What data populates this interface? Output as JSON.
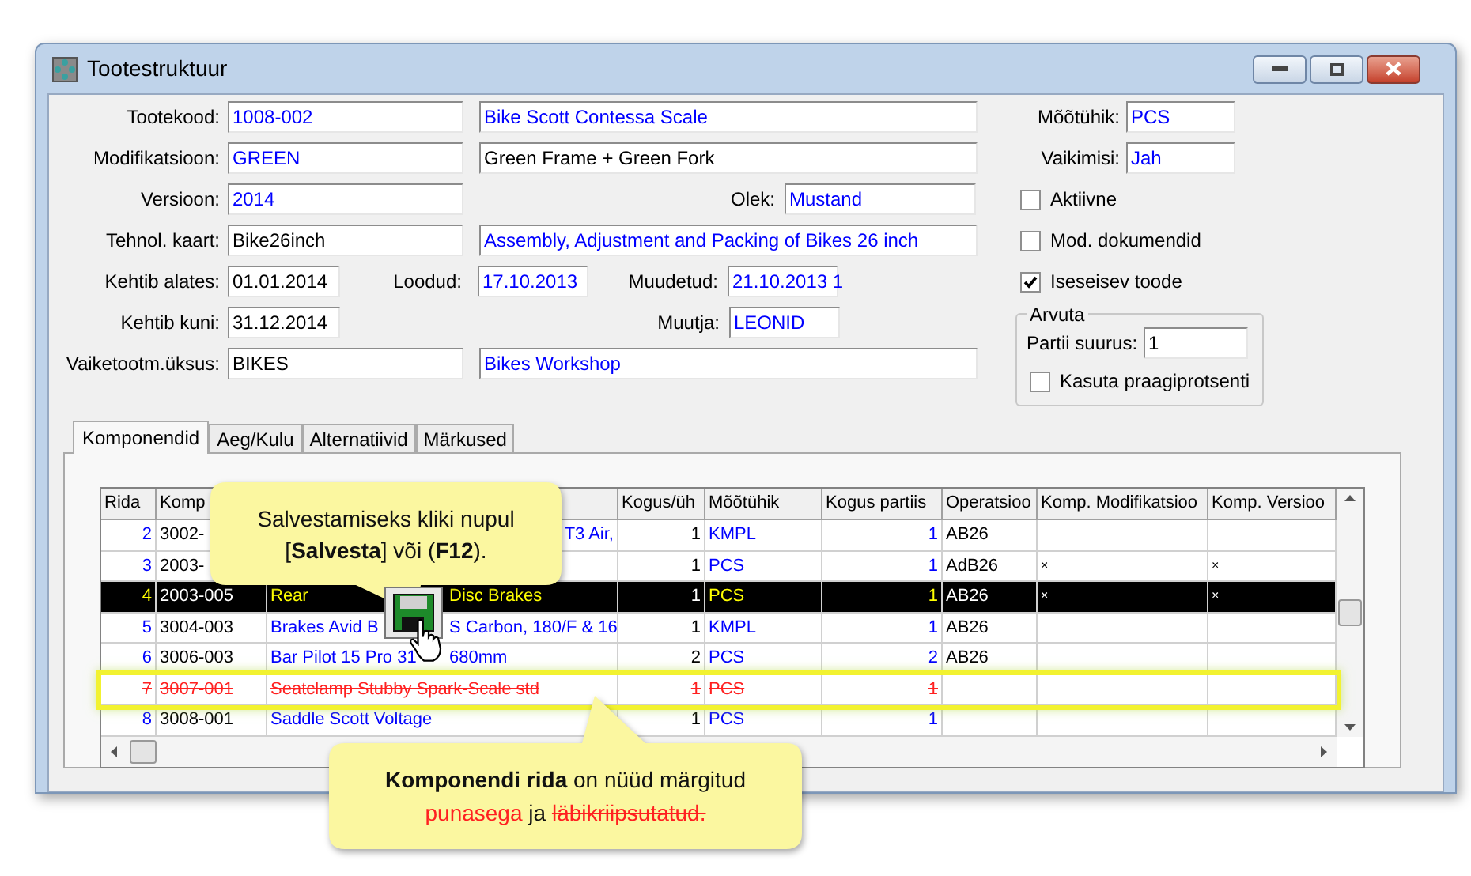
{
  "window": {
    "title": "Tootestruktuur"
  },
  "form": {
    "rows": [
      {
        "label": "Tootekood:",
        "fields": [
          {
            "value": "1008-002",
            "linked": true
          },
          {
            "value": "Bike Scott Contessa Scale",
            "linked": true
          }
        ]
      },
      {
        "label": "Modifikatsioon:",
        "fields": [
          {
            "value": "GREEN",
            "linked": true
          },
          {
            "value": "Green Frame + Green Fork",
            "linked": false
          }
        ]
      },
      {
        "label": "Versioon:",
        "fields": [
          {
            "value": "2014",
            "linked": true
          }
        ],
        "extra": [
          {
            "label": "Olek:",
            "value": "Mustand",
            "linked": true
          }
        ]
      },
      {
        "label": "Tehnol. kaart:",
        "fields": [
          {
            "value": "Bike26inch",
            "linked": false
          },
          {
            "value": "Assembly, Adjustment and Packing of Bikes 26 inch",
            "linked": true
          }
        ]
      },
      {
        "label": "Kehtib alates:",
        "fields": [
          {
            "value": "01.01.2014",
            "linked": false
          }
        ],
        "extra": [
          {
            "label": "Loodud:",
            "value": "17.10.2013",
            "linked": true
          },
          {
            "label": "Muudetud:",
            "value": "21.10.2013 1",
            "linked": true
          }
        ]
      },
      {
        "label": "Kehtib kuni:",
        "fields": [
          {
            "value": "31.12.2014",
            "linked": false
          }
        ],
        "extra": [
          {
            "label": "Muutja:",
            "value": "LEONID",
            "linked": true
          }
        ]
      },
      {
        "label": "Vaiketootm.üksus:",
        "fields": [
          {
            "value": "BIKES",
            "linked": false
          },
          {
            "value": "Bikes Workshop",
            "linked": true
          }
        ]
      }
    ],
    "side_fields": [
      {
        "label": "Mõõtühik:",
        "value": "PCS",
        "linked": true
      },
      {
        "label": "Vaikimisi:",
        "value": "Jah",
        "linked": true
      }
    ],
    "checkboxes": [
      {
        "label": "Aktiivne",
        "checked": false
      },
      {
        "label": "Mod. dokumendid",
        "checked": false
      },
      {
        "label": "Iseseisev toode",
        "checked": true
      }
    ],
    "group": {
      "title": "Arvuta",
      "field": {
        "label": "Partii suurus:",
        "value": "1"
      },
      "checkbox": {
        "label": "Kasuta praagiprotsenti",
        "checked": false
      }
    }
  },
  "tabs": [
    {
      "label": "Komponendid",
      "selected": true
    },
    {
      "label": "Aeg/Kulu",
      "selected": false
    },
    {
      "label": "Alternatiivid",
      "selected": false
    },
    {
      "label": "Märkused",
      "selected": false
    }
  ],
  "table": {
    "columns": [
      {
        "label": "Rida",
        "kind": "number",
        "linked": true
      },
      {
        "label": "Komp",
        "kind": "text",
        "linked": false
      },
      {
        "kind": "name",
        "linked": true
      },
      {
        "label": "Kogus/üh",
        "kind": "number",
        "linked": false
      },
      {
        "label": "Mõõtühik",
        "kind": "text",
        "linked": true
      },
      {
        "label": "Kogus partiis",
        "kind": "number",
        "linked": true
      },
      {
        "label": "Operatsioo",
        "kind": "text",
        "linked": false
      },
      {
        "label": "Komp. Modifikatsioo",
        "kind": "mark",
        "linked": false
      },
      {
        "label": "Komp. Versioo",
        "kind": "mark",
        "linked": false
      }
    ],
    "rows": [
      {
        "cells": [
          "2",
          "3002-",
          {
            "tail": "T3 Air,"
          },
          "1",
          "KMPL",
          "1",
          "AB26"
        ],
        "selected": false,
        "deleted": false,
        "highlighted": false
      },
      {
        "cells": [
          "3",
          "2003-",
          "",
          "1",
          "PCS",
          "1",
          "AdB26",
          "×",
          "×"
        ],
        "selected": false,
        "deleted": false,
        "highlighted": false
      },
      {
        "cells": [
          "4",
          "2003-005",
          {
            "parts": [
              "Rear",
              "Disc Brakes"
            ]
          },
          "1",
          "PCS",
          "1",
          "AB26",
          "×",
          "×"
        ],
        "selected": true,
        "deleted": false,
        "highlighted": false
      },
      {
        "cells": [
          "5",
          "3004-003",
          {
            "parts": [
              "Brakes Avid B",
              "S Carbon, 180/F & 16"
            ]
          },
          "1",
          "KMPL",
          "1",
          "AB26"
        ],
        "selected": false,
        "deleted": false,
        "highlighted": false
      },
      {
        "cells": [
          "6",
          "3006-003",
          {
            "parts": [
              "Bar Pilot 15 Pro 31",
              "680mm"
            ]
          },
          "2",
          "PCS",
          "2",
          "AB26"
        ],
        "selected": false,
        "deleted": false,
        "highlighted": false
      },
      {
        "cells": [
          "7",
          "3007-001",
          {
            "parts": [
              "Seatclamp Stubby Spark-Scale std"
            ]
          },
          "1",
          "PCS",
          "1"
        ],
        "selected": false,
        "deleted": true,
        "highlighted": true
      },
      {
        "cells": [
          "8",
          "3008-001",
          {
            "parts": [
              "Saddle Scott Voltage"
            ]
          },
          "1",
          "PCS",
          "1"
        ],
        "selected": false,
        "deleted": false,
        "highlighted": false
      }
    ]
  },
  "callouts": [
    {
      "text": "Salvestamiseks kliki nupul [**Salvesta**] või (**F12**)."
    },
    {
      "segments": [
        {
          "text": "Komponendi rida",
          "kind": "bold"
        },
        {
          "text": "on nüüd märgitud",
          "kind": "plain"
        },
        {
          "text": "punasega",
          "kind": "red"
        },
        {
          "text": "ja",
          "kind": "plain"
        },
        {
          "text": "läbikriipsutatud.",
          "kind": "struck"
        }
      ]
    }
  ]
}
